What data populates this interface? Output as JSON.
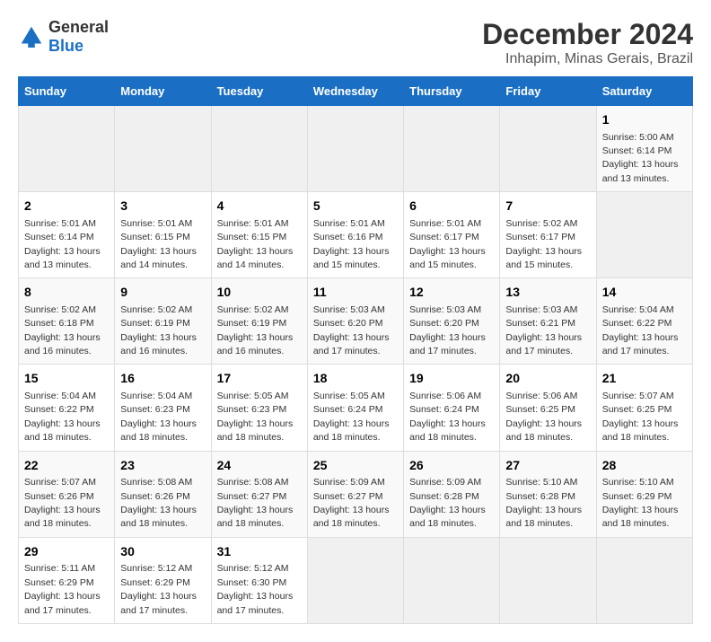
{
  "header": {
    "logo_general": "General",
    "logo_blue": "Blue",
    "title": "December 2024",
    "subtitle": "Inhapim, Minas Gerais, Brazil"
  },
  "calendar": {
    "days_of_week": [
      "Sunday",
      "Monday",
      "Tuesday",
      "Wednesday",
      "Thursday",
      "Friday",
      "Saturday"
    ],
    "weeks": [
      [
        null,
        null,
        null,
        null,
        null,
        null,
        {
          "day": "1",
          "sunrise": "5:00 AM",
          "sunset": "6:14 PM",
          "daylight_h": "13",
          "daylight_m": "13"
        }
      ],
      [
        {
          "day": "2",
          "sunrise": "5:01 AM",
          "sunset": "6:14 PM",
          "daylight_h": "13",
          "daylight_m": "13"
        },
        {
          "day": "3",
          "sunrise": "5:01 AM",
          "sunset": "6:15 PM",
          "daylight_h": "13",
          "daylight_m": "14"
        },
        {
          "day": "4",
          "sunrise": "5:01 AM",
          "sunset": "6:15 PM",
          "daylight_h": "13",
          "daylight_m": "14"
        },
        {
          "day": "5",
          "sunrise": "5:01 AM",
          "sunset": "6:16 PM",
          "daylight_h": "13",
          "daylight_m": "15"
        },
        {
          "day": "6",
          "sunrise": "5:01 AM",
          "sunset": "6:17 PM",
          "daylight_h": "13",
          "daylight_m": "15"
        },
        {
          "day": "7",
          "sunrise": "5:02 AM",
          "sunset": "6:17 PM",
          "daylight_h": "13",
          "daylight_m": "15"
        }
      ],
      [
        {
          "day": "8",
          "sunrise": "5:02 AM",
          "sunset": "6:18 PM",
          "daylight_h": "13",
          "daylight_m": "16"
        },
        {
          "day": "9",
          "sunrise": "5:02 AM",
          "sunset": "6:19 PM",
          "daylight_h": "13",
          "daylight_m": "16"
        },
        {
          "day": "10",
          "sunrise": "5:02 AM",
          "sunset": "6:19 PM",
          "daylight_h": "13",
          "daylight_m": "16"
        },
        {
          "day": "11",
          "sunrise": "5:03 AM",
          "sunset": "6:20 PM",
          "daylight_h": "13",
          "daylight_m": "17"
        },
        {
          "day": "12",
          "sunrise": "5:03 AM",
          "sunset": "6:20 PM",
          "daylight_h": "13",
          "daylight_m": "17"
        },
        {
          "day": "13",
          "sunrise": "5:03 AM",
          "sunset": "6:21 PM",
          "daylight_h": "13",
          "daylight_m": "17"
        },
        {
          "day": "14",
          "sunrise": "5:04 AM",
          "sunset": "6:22 PM",
          "daylight_h": "13",
          "daylight_m": "17"
        }
      ],
      [
        {
          "day": "15",
          "sunrise": "5:04 AM",
          "sunset": "6:22 PM",
          "daylight_h": "13",
          "daylight_m": "18"
        },
        {
          "day": "16",
          "sunrise": "5:04 AM",
          "sunset": "6:23 PM",
          "daylight_h": "13",
          "daylight_m": "18"
        },
        {
          "day": "17",
          "sunrise": "5:05 AM",
          "sunset": "6:23 PM",
          "daylight_h": "13",
          "daylight_m": "18"
        },
        {
          "day": "18",
          "sunrise": "5:05 AM",
          "sunset": "6:24 PM",
          "daylight_h": "13",
          "daylight_m": "18"
        },
        {
          "day": "19",
          "sunrise": "5:06 AM",
          "sunset": "6:24 PM",
          "daylight_h": "13",
          "daylight_m": "18"
        },
        {
          "day": "20",
          "sunrise": "5:06 AM",
          "sunset": "6:25 PM",
          "daylight_h": "13",
          "daylight_m": "18"
        },
        {
          "day": "21",
          "sunrise": "5:07 AM",
          "sunset": "6:25 PM",
          "daylight_h": "13",
          "daylight_m": "18"
        }
      ],
      [
        {
          "day": "22",
          "sunrise": "5:07 AM",
          "sunset": "6:26 PM",
          "daylight_h": "13",
          "daylight_m": "18"
        },
        {
          "day": "23",
          "sunrise": "5:08 AM",
          "sunset": "6:26 PM",
          "daylight_h": "13",
          "daylight_m": "18"
        },
        {
          "day": "24",
          "sunrise": "5:08 AM",
          "sunset": "6:27 PM",
          "daylight_h": "13",
          "daylight_m": "18"
        },
        {
          "day": "25",
          "sunrise": "5:09 AM",
          "sunset": "6:27 PM",
          "daylight_h": "13",
          "daylight_m": "18"
        },
        {
          "day": "26",
          "sunrise": "5:09 AM",
          "sunset": "6:28 PM",
          "daylight_h": "13",
          "daylight_m": "18"
        },
        {
          "day": "27",
          "sunrise": "5:10 AM",
          "sunset": "6:28 PM",
          "daylight_h": "13",
          "daylight_m": "18"
        },
        {
          "day": "28",
          "sunrise": "5:10 AM",
          "sunset": "6:29 PM",
          "daylight_h": "13",
          "daylight_m": "18"
        }
      ],
      [
        {
          "day": "29",
          "sunrise": "5:11 AM",
          "sunset": "6:29 PM",
          "daylight_h": "13",
          "daylight_m": "17"
        },
        {
          "day": "30",
          "sunrise": "5:12 AM",
          "sunset": "6:29 PM",
          "daylight_h": "13",
          "daylight_m": "17"
        },
        {
          "day": "31",
          "sunrise": "5:12 AM",
          "sunset": "6:30 PM",
          "daylight_h": "13",
          "daylight_m": "17"
        },
        null,
        null,
        null,
        null
      ]
    ]
  }
}
